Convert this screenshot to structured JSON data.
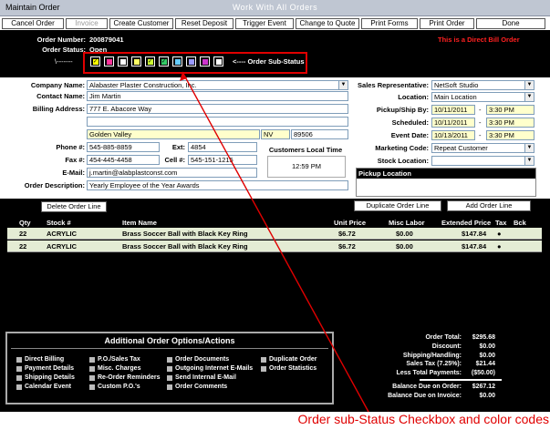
{
  "window": {
    "title": "Maintain Order",
    "caption": "Work With All Orders"
  },
  "toolbar": [
    "Cancel Order",
    "Invoice",
    "Create Customer",
    "Reset Deposit",
    "Trigger Event",
    "Change to Quote",
    "Print Forms",
    "Print Order",
    "Done"
  ],
  "header": {
    "order_number_label": "Order Number:",
    "order_number": "200879041",
    "order_status_label": "Order Status:",
    "order_status": "Open",
    "direct_bill": "This is a Direct Bill Order",
    "substatus_arrow_left": "\\-------",
    "substatus_label": "<---- Order Sub-Status",
    "substatus_colors": [
      "#ffff00",
      "#ff3399",
      "#ffffff",
      "#ffff66",
      "#ccff33",
      "#33cc66",
      "#66ccff",
      "#9999ff",
      "#cc33cc",
      "#ffffff"
    ],
    "substatus_checked": [
      true,
      false,
      false,
      false,
      true,
      true,
      false,
      false,
      false,
      false
    ]
  },
  "form": {
    "company_name_label": "Company Name:",
    "company_name": "Alabaster Plaster Construction, Inc.",
    "contact_name_label": "Contact Name:",
    "contact_name": "Jim Martin",
    "billing_address_label": "Billing Address:",
    "address1": "777 E. Abacore Way",
    "city": "Golden Valley",
    "state": "NV",
    "zip": "89506",
    "phone_label": "Phone #:",
    "phone": "545-885-8859",
    "ext_label": "Ext:",
    "ext": "4854",
    "fax_label": "Fax #:",
    "fax": "454-445-4458",
    "cell_label": "Cell #:",
    "cell": "545-151-1215",
    "email_label": "E-Mail:",
    "email": "j.martin@alabplastconst.com",
    "order_desc_label": "Order Description:",
    "order_desc": "Yearly Employee of the Year Awards",
    "local_time_label": "Customers Local Time",
    "local_time": "12:59 PM",
    "sales_rep_label": "Sales Representative:",
    "sales_rep": "NetSoft Studio",
    "location_label": "Location:",
    "location": "Main Location",
    "pickup_label": "Pickup/Ship By:",
    "pickup_date": "10/11/2011",
    "pickup_time": "3:30 PM",
    "scheduled_label": "Scheduled:",
    "scheduled_date": "10/11/2011",
    "scheduled_time": "3:30 PM",
    "event_label": "Event Date:",
    "event_date": "10/13/2011",
    "event_time": "3:30 PM",
    "marketing_label": "Marketing Code:",
    "marketing": "Repeat Customer",
    "stock_label": "Stock Location:",
    "stock": "",
    "pickup_location_label": "Pickup Location",
    "dash": "-"
  },
  "grid": {
    "delete_button": "Delete Order Line",
    "duplicate_button": "Duplicate Order Line",
    "add_button": "Add Order Line",
    "headers": [
      "Qty",
      "Stock #",
      "Item Name",
      "Unit Price",
      "Misc Labor",
      "Extended Price",
      "Tax",
      "Bck"
    ],
    "rows": [
      {
        "qty": "22",
        "stock": "ACRYLIC",
        "item": "Brass Soccer Ball with Black Key Ring",
        "unit": "$6.72",
        "misc": "$0.00",
        "ext": "$147.84",
        "tax": "●"
      },
      {
        "qty": "22",
        "stock": "ACRYLIC",
        "item": "Brass Soccer Ball with Black Key Ring",
        "unit": "$6.72",
        "misc": "$0.00",
        "ext": "$147.84",
        "tax": "●"
      }
    ]
  },
  "options": {
    "title": "Additional Order Options/Actions",
    "col1": [
      "Direct Billing",
      "Payment Details",
      "Shipping Details",
      "Calendar Event"
    ],
    "col2": [
      "P.O./Sales Tax",
      "Misc. Charges",
      "Re-Order Reminders",
      "Custom P.O.'s"
    ],
    "col3": [
      "Order Documents",
      "Outgoing Internet E-Mails",
      "Send Internal E-Mail",
      "Order Comments"
    ],
    "col4": [
      "Duplicate Order",
      "Order Statistics"
    ]
  },
  "totals": [
    {
      "label": "Order Total:",
      "value": "$295.68"
    },
    {
      "label": "Discount:",
      "value": "$0.00"
    },
    {
      "label": "Shipping/Handling:",
      "value": "$0.00"
    },
    {
      "label": "Sales Tax (7.25%):",
      "value": "$21.44"
    },
    {
      "label": "Less Total Payments:",
      "value": "($50.00)"
    },
    {
      "label": "Balance Due on Order:",
      "value": "$267.12"
    },
    {
      "label": "Balance Due on Invoice:",
      "value": "$0.00"
    }
  ],
  "annotation": "Order sub-Status Checkbox and color codes"
}
